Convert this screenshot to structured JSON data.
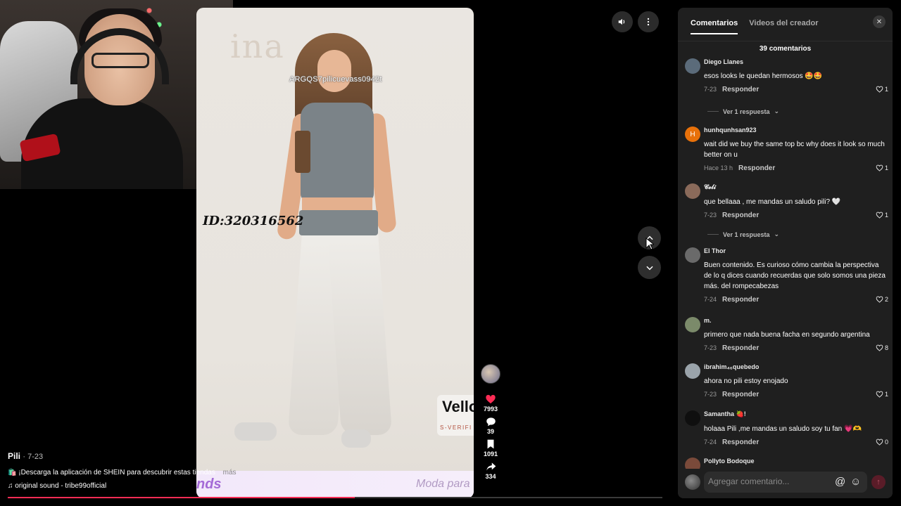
{
  "video": {
    "overlay_username": "ARGQS7pilicuevass0942t",
    "overlay_id": "ID:320316562",
    "brand_ghost": "ina",
    "banner_title": "Vello",
    "banner_sub": "S-VERIFI",
    "strip_left": "nds",
    "strip_right": "Moda para"
  },
  "controls": {
    "volume_icon": "volume-icon",
    "more_icon": "more-icon",
    "prev_icon": "chevron-up-icon",
    "next_icon": "chevron-down-icon"
  },
  "actions": {
    "likes": "7993",
    "comments": "39",
    "saves": "1091",
    "shares": "334"
  },
  "caption": {
    "author": "Pili",
    "date": "· 7-23",
    "description": "¡Descarga la aplicación de SHEIN para descubrir estas tiendas",
    "more": "más",
    "sound": "original sound - tribe99official"
  },
  "progress": {
    "fraction": 0.53
  },
  "panel": {
    "tabs": [
      {
        "label": "Comentarios",
        "active": true
      },
      {
        "label": "Videos del creador",
        "active": false
      }
    ],
    "comment_count": "39 comentarios",
    "see_replies": "Ver 1 respuesta",
    "reply_label": "Responder",
    "input_placeholder": "Agregar comentario...",
    "comments": [
      {
        "name": "Diego Llanes",
        "text": "esos looks le quedan hermosos 🤩🤩",
        "date": "7-23",
        "likes": "1",
        "avatar_color": "#5b6b7a",
        "avatar_letter": ""
      },
      {
        "name": "hunhqunhsan923",
        "text": "wait did we buy the same top bc why does it look so much better on u",
        "date": "Hace 13 h",
        "likes": "1",
        "avatar_color": "#e8710a",
        "avatar_letter": "H"
      },
      {
        "name": "𝓒𝓮𝓵𝓲",
        "text": "que bellaaa , me mandas un saludo pili? 🤍",
        "date": "7-23",
        "likes": "1",
        "avatar_color": "#8a6a5a",
        "avatar_letter": ""
      },
      {
        "name": "El Thor",
        "text": "Buen contenido. Es curioso cómo cambia la perspectiva de lo q dices cuando recuerdas que solo somos una pieza más. del rompecabezas",
        "date": "7-24",
        "likes": "2",
        "avatar_color": "#6a6a6a",
        "avatar_letter": ""
      },
      {
        "name": "m.",
        "text": "primero que nada buena facha en segundo argentina",
        "date": "7-23",
        "likes": "8",
        "avatar_color": "#7b8a6a",
        "avatar_letter": ""
      },
      {
        "name": "ibrahim₄₆quebedo",
        "text": "ahora no pili estoy enojado",
        "date": "7-23",
        "likes": "1",
        "avatar_color": "#9aa3aa",
        "avatar_letter": ""
      },
      {
        "name": "Samantha 🍓!",
        "text": "holaaa Pili ,me mandas un saludo soy tu fan 💗🫶",
        "date": "7-24",
        "likes": "0",
        "avatar_color": "#0f0f0f",
        "avatar_letter": ""
      },
      {
        "name": "Pollyto Bodoque",
        "text": "",
        "date": "",
        "likes": "",
        "avatar_color": "#7a4a3a",
        "avatar_letter": ""
      }
    ]
  }
}
